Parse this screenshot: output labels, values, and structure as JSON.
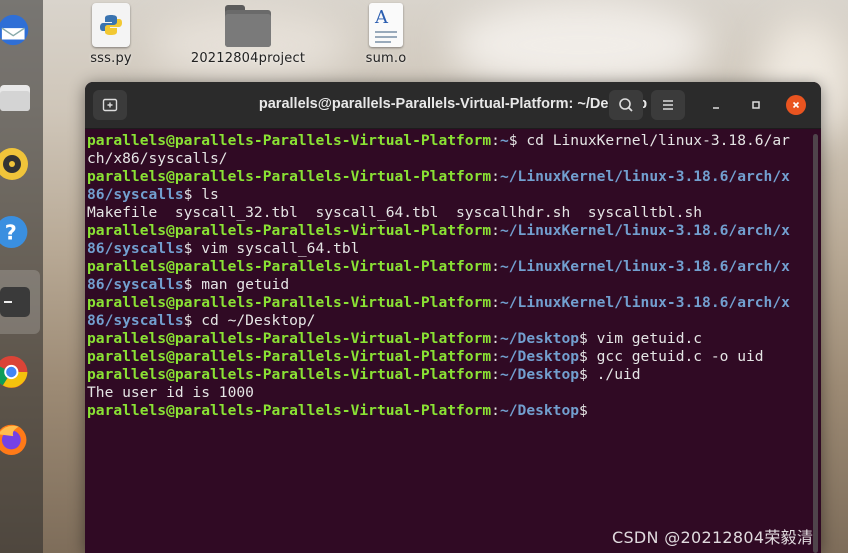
{
  "desktop": {
    "icons": [
      {
        "label": "sss.py",
        "icon": "python-file-icon"
      },
      {
        "label": "20212804project",
        "icon": "folder-icon"
      },
      {
        "label": "sum.o",
        "icon": "text-document-icon"
      }
    ]
  },
  "dock": {
    "items": [
      "thunderbird-icon",
      "files-icon",
      "rhythmbox-icon",
      "help-icon",
      "terminal-icon",
      "chrome-icon",
      "firefox-icon"
    ]
  },
  "terminal": {
    "title": "parallels@parallels-Parallels-Virtual-Platform: ~/Desktop",
    "lines": [
      {
        "user": "parallels@parallels-Parallels-Virtual-Platform",
        "path": "~",
        "cmd": " cd LinuxKernel/linux-3.18.6/ar"
      },
      {
        "out": "ch/x86/syscalls/"
      },
      {
        "user": "parallels@parallels-Parallels-Virtual-Platform",
        "path": "~/LinuxKernel/linux-3.18.6/arch/x"
      },
      {
        "path": "86/syscalls",
        "cmd": " ls"
      },
      {
        "out": "Makefile  syscall_32.tbl  syscall_64.tbl  syscallhdr.sh  syscalltbl.sh"
      },
      {
        "user": "parallels@parallels-Parallels-Virtual-Platform",
        "path": "~/LinuxKernel/linux-3.18.6/arch/x"
      },
      {
        "path": "86/syscalls",
        "cmd": " vim syscall_64.tbl"
      },
      {
        "user": "parallels@parallels-Parallels-Virtual-Platform",
        "path": "~/LinuxKernel/linux-3.18.6/arch/x"
      },
      {
        "path": "86/syscalls",
        "cmd": " man getuid"
      },
      {
        "user": "parallels@parallels-Parallels-Virtual-Platform",
        "path": "~/LinuxKernel/linux-3.18.6/arch/x"
      },
      {
        "path": "86/syscalls",
        "cmd": " cd ~/Desktop/"
      },
      {
        "user": "parallels@parallels-Parallels-Virtual-Platform",
        "path": "~/Desktop",
        "cmd": " vim getuid.c"
      },
      {
        "user": "parallels@parallels-Parallels-Virtual-Platform",
        "path": "~/Desktop",
        "cmd": " gcc getuid.c -o uid"
      },
      {
        "user": "parallels@parallels-Parallels-Virtual-Platform",
        "path": "~/Desktop",
        "cmd": " ./uid"
      },
      {
        "out": "The user id is 1000"
      },
      {
        "user": "parallels@parallels-Parallels-Virtual-Platform",
        "path": "~/Desktop",
        "cmd": ""
      }
    ]
  },
  "watermark": "CSDN @20212804荣毅清",
  "colors": {
    "terminal_bg": "#300a24",
    "user": "#8ae234",
    "path": "#729fcf",
    "close": "#e95420"
  }
}
